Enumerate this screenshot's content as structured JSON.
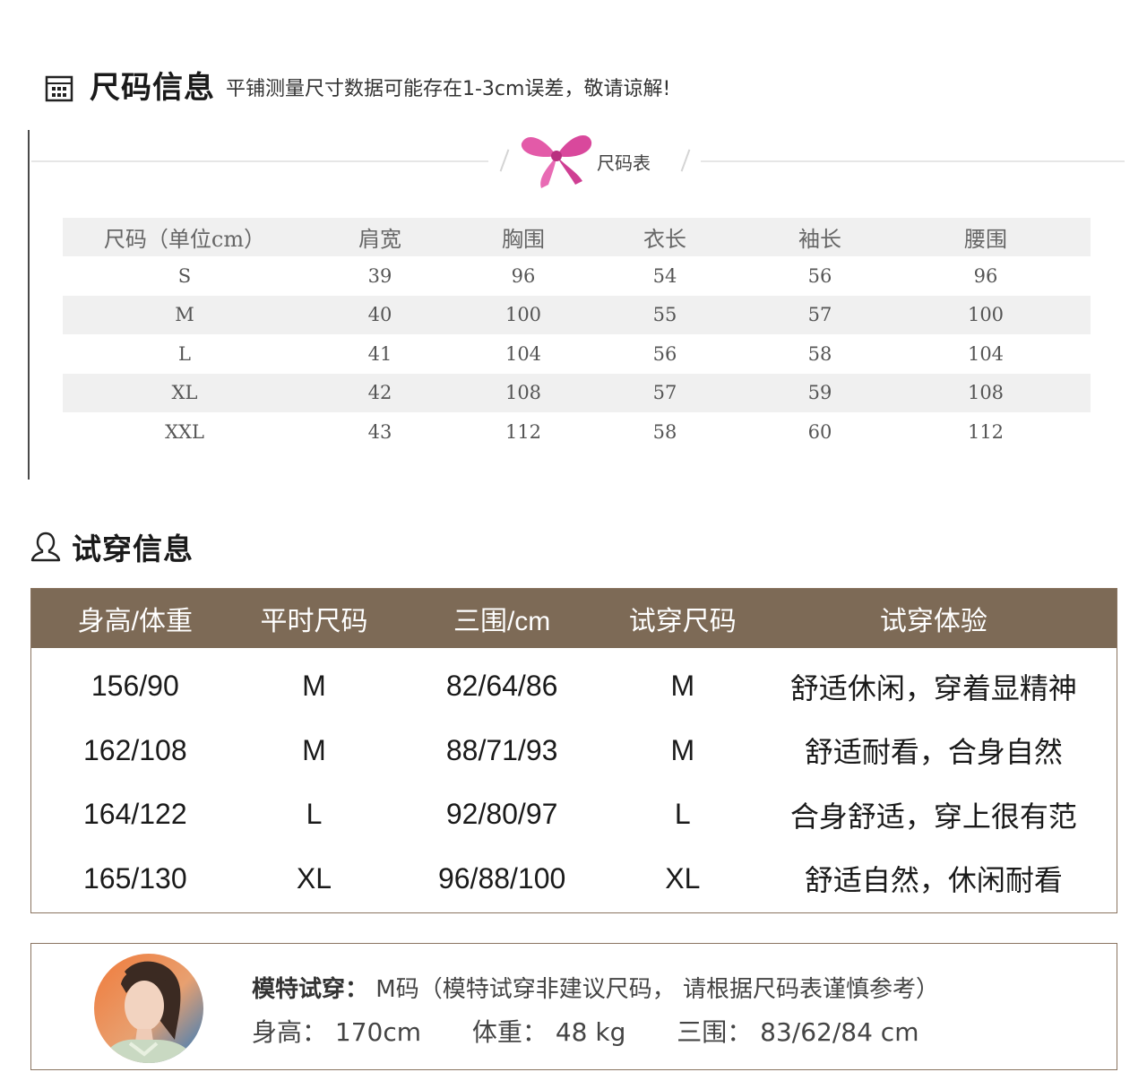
{
  "size_section": {
    "title": "尺码信息",
    "note": "平铺测量尺寸数据可能存在1-3cm误差，敬请谅解!",
    "ribbon_label": "尺码表",
    "headers": [
      "尺码（单位cm）",
      "肩宽",
      "胸围",
      "衣长",
      "袖长",
      "腰围"
    ],
    "rows": [
      [
        "S",
        "39",
        "96",
        "54",
        "56",
        "96"
      ],
      [
        "M",
        "40",
        "100",
        "55",
        "57",
        "100"
      ],
      [
        "L",
        "41",
        "104",
        "56",
        "58",
        "104"
      ],
      [
        "XL",
        "42",
        "108",
        "57",
        "59",
        "108"
      ],
      [
        "XXL",
        "43",
        "112",
        "58",
        "60",
        "112"
      ]
    ]
  },
  "fit_section": {
    "title": "试穿信息",
    "headers": [
      "身高/体重",
      "平时尺码",
      "三围/cm",
      "试穿尺码",
      "试穿体验"
    ],
    "rows": [
      [
        "156/90",
        "M",
        "82/64/86",
        "M",
        "舒适休闲，穿着显精神"
      ],
      [
        "162/108",
        "M",
        "88/71/93",
        "M",
        "舒适耐看，合身自然"
      ],
      [
        "164/122",
        "L",
        "92/80/97",
        "L",
        "合身舒适，穿上很有范"
      ],
      [
        "165/130",
        "XL",
        "96/88/100",
        "XL",
        "舒适自然，休闲耐看"
      ]
    ],
    "header_color": "#7d6a56"
  },
  "model": {
    "label": "模特试穿：",
    "value": " M码（模特试穿非建议尺码， 请根据尺码表谨慎参考）",
    "height": "身高： 170cm",
    "weight": "体重： 48 kg",
    "measurements": "三围： 83/62/84 cm"
  },
  "icons": {
    "size_section": "calendar-grid-icon",
    "ribbon": "pink-bow-icon",
    "fit_section": "person-outline-icon",
    "model": "model-avatar-photo"
  }
}
